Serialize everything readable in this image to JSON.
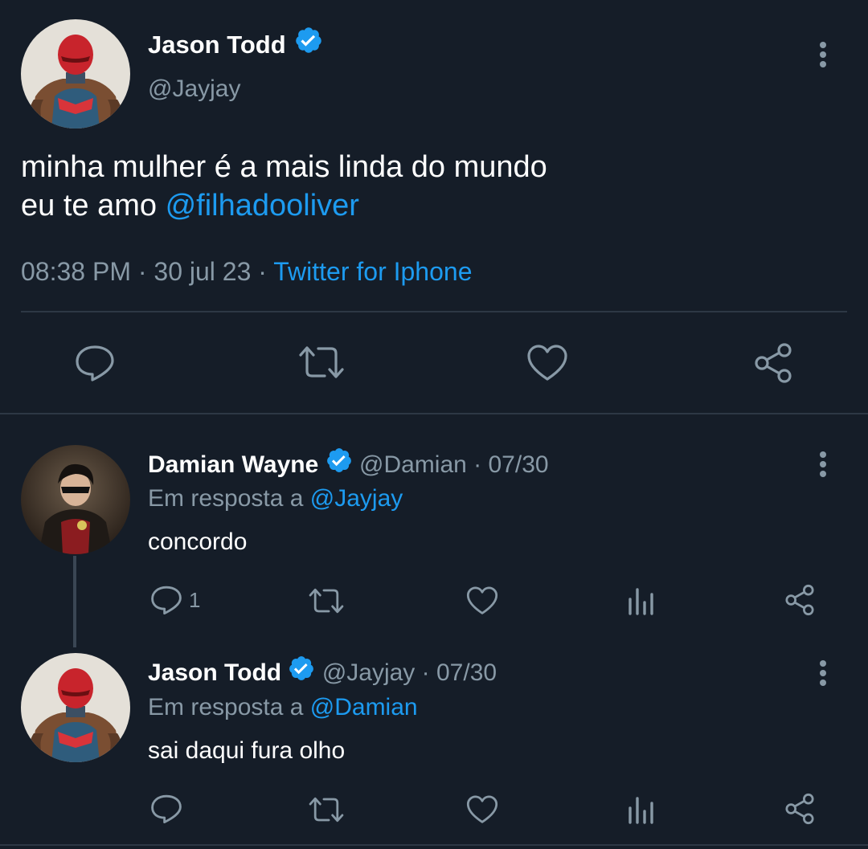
{
  "main_tweet": {
    "author_name": "Jason Todd",
    "author_handle": "@Jayjay",
    "text_line1": "minha mulher é a mais linda do mundo",
    "text_line2_prefix": "eu te amo ",
    "mention": "@filhadooliver",
    "time": "08:38 PM",
    "separator1": "·",
    "date": "30 jul 23",
    "separator2": "·",
    "source": "Twitter for Iphone"
  },
  "replies": [
    {
      "author_name": "Damian Wayne",
      "author_handle": "@Damian",
      "separator": "·",
      "date": "07/30",
      "reply_prefix": "Em resposta a ",
      "reply_to": "@Jayjay",
      "text": "concordo",
      "reply_count": "1"
    },
    {
      "author_name": "Jason Todd",
      "author_handle": "@Jayjay",
      "separator": "·",
      "date": "07/30",
      "reply_prefix": "Em resposta a ",
      "reply_to": "@Damian",
      "text": "sai daqui fura olho",
      "reply_count": ""
    }
  ],
  "colors": {
    "background": "#151d28",
    "accent": "#1d9bf0",
    "muted": "#8899a6",
    "divider": "#2d3845"
  },
  "icons": {
    "reply": "comment-bubble-icon",
    "retweet": "retweet-icon",
    "like": "heart-icon",
    "share": "share-icon",
    "analytics": "bar-chart-icon",
    "more": "more-vertical-icon",
    "verified": "verified-badge-icon"
  }
}
